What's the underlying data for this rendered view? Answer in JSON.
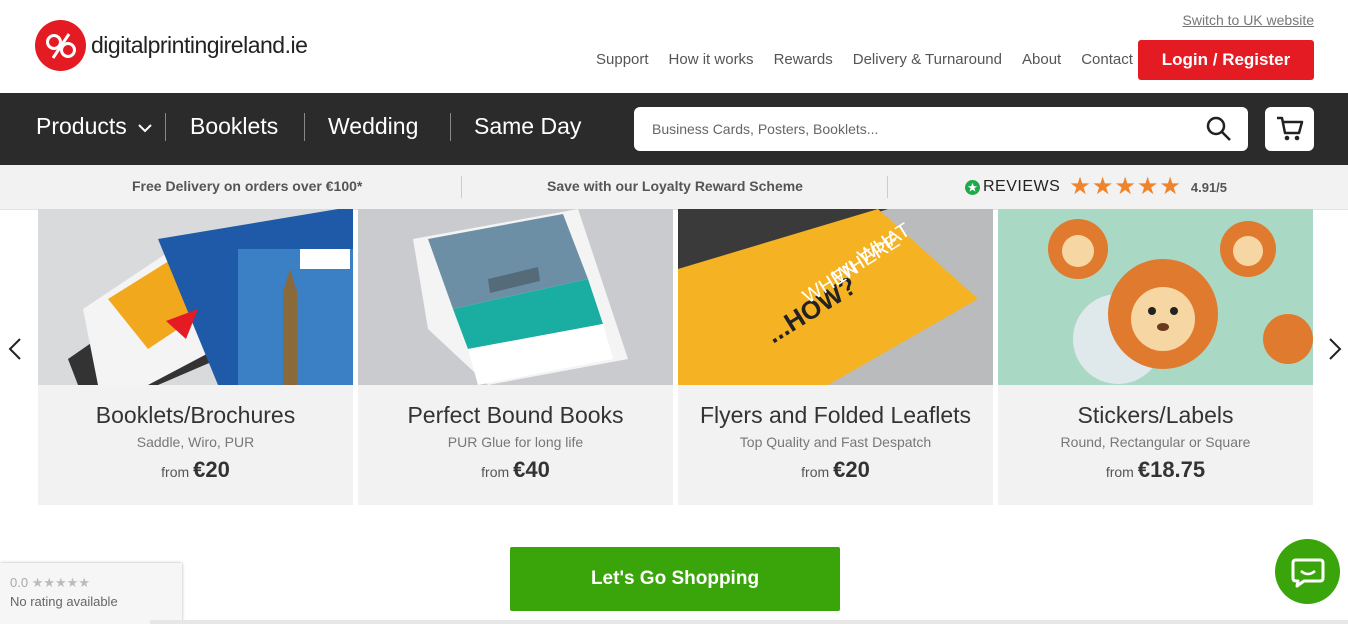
{
  "header": {
    "logo_text": "digitalprintingireland.ie",
    "switch_link": "Switch to UK website",
    "top_nav": [
      "Support",
      "How it works",
      "Rewards",
      "Delivery & Turnaround",
      "About",
      "Contact"
    ],
    "login_label": "Login / Register"
  },
  "navbar": {
    "items": [
      "Products",
      "Booklets",
      "Wedding",
      "Same Day"
    ],
    "search_placeholder": "Business Cards, Posters, Booklets..."
  },
  "infobar": {
    "delivery": "Free Delivery on orders over €100*",
    "loyalty": "Save with our Loyalty Reward Scheme",
    "reviews_label": "REVIEWS",
    "rating": "4.91/5"
  },
  "products": [
    {
      "title": "Booklets/Brochures",
      "subtitle": "Saddle, Wiro, PUR",
      "from": "from",
      "price": "€20"
    },
    {
      "title": "Perfect Bound Books",
      "subtitle": "PUR Glue for long life",
      "from": "from",
      "price": "€40"
    },
    {
      "title": "Flyers and Folded Leaflets",
      "subtitle": "Top Quality and Fast Despatch",
      "from": "from",
      "price": "€20"
    },
    {
      "title": "Stickers/Labels",
      "subtitle": "Round, Rectangular or Square",
      "from": "from",
      "price": "€18.75"
    }
  ],
  "cta": {
    "label": "Let's Go Shopping"
  },
  "rating_widget": {
    "score": "0.0",
    "text": "No rating available"
  },
  "colors": {
    "brand_red": "#e41b23",
    "cta_green": "#3aa50a",
    "nav_dark": "#2b2b2b",
    "star_orange": "#f0842c"
  }
}
